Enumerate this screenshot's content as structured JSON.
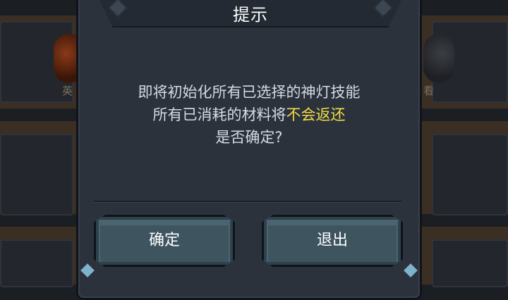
{
  "background": {
    "left_fragment": "英",
    "right_fragment": "看"
  },
  "dialog": {
    "title": "提示",
    "message_line1": "即将初始化所有已选择的神灯技能",
    "message_line2_prefix": "所有已消耗的材料将",
    "message_line2_highlight": "不会返还",
    "message_line3": "是否确定?",
    "confirm_label": "确定",
    "exit_label": "退出"
  },
  "colors": {
    "highlight": "#f2dc4a",
    "panel": "#2b323c",
    "button": "#3e5560"
  }
}
